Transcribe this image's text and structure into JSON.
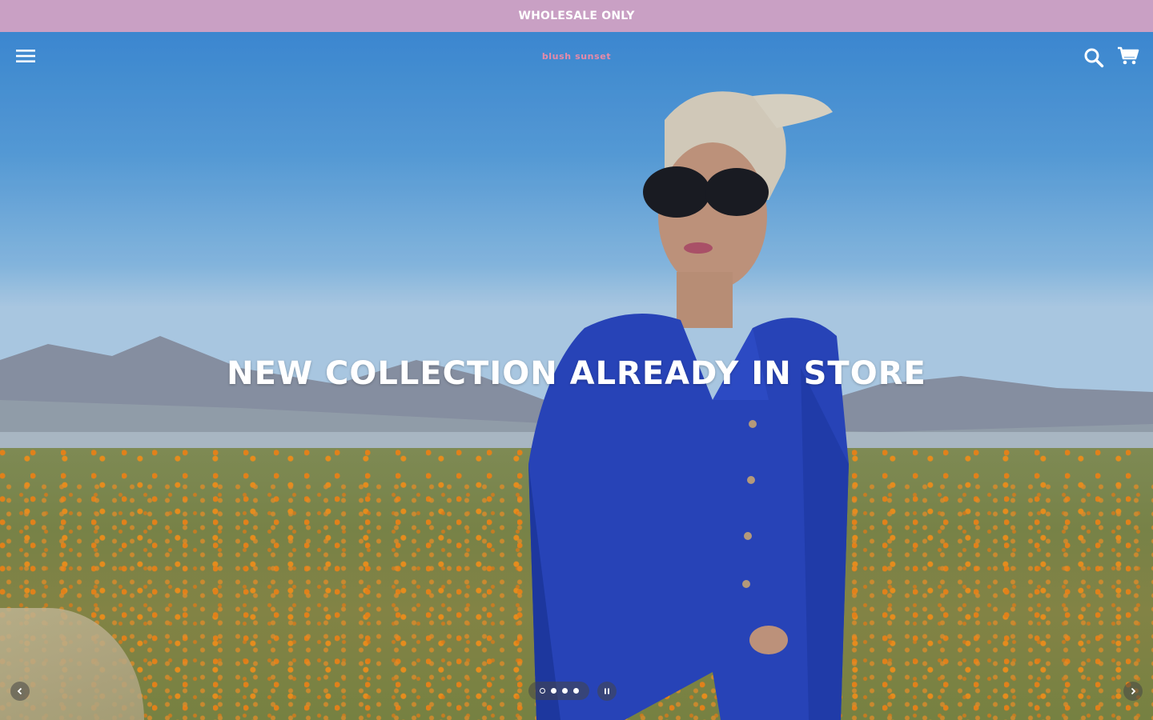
{
  "announcement": {
    "text": "WHOLESALE ONLY",
    "background": "#c9a0c4"
  },
  "header": {
    "logo_text": "blush sunset",
    "logo_color": "#e88aa8",
    "menu_icon": "hamburger-menu-icon",
    "search_icon": "search-icon",
    "cart_icon": "cart-icon"
  },
  "hero": {
    "headline": "NEW COLLECTION ALREADY IN STORE",
    "image_description_icon": "hero-photo",
    "slides": {
      "count": 4,
      "active_index": 0
    },
    "prev_icon": "chevron-left-icon",
    "next_icon": "chevron-right-icon",
    "pause_icon": "pause-icon"
  }
}
